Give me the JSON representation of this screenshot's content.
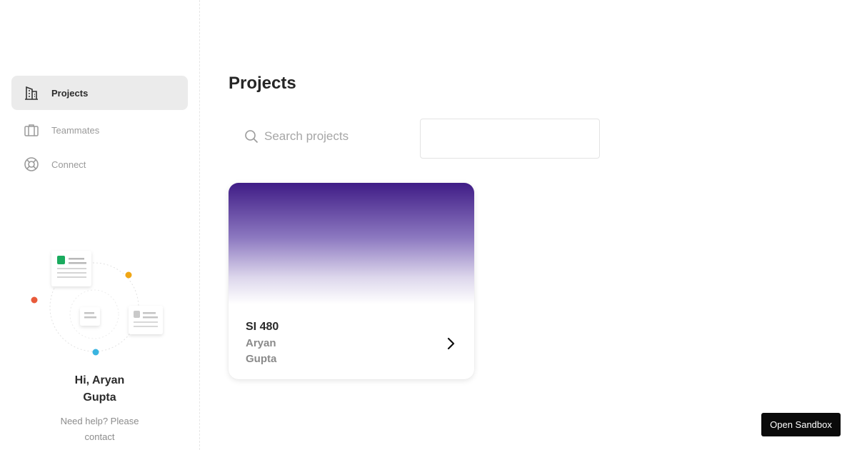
{
  "sidebar": {
    "items": [
      {
        "label": "Projects",
        "icon": "building-icon",
        "active": true
      },
      {
        "label": "Teammates",
        "icon": "briefcase-icon",
        "active": false
      },
      {
        "label": "Connect",
        "icon": "lifebuoy-icon",
        "active": false
      }
    ],
    "greeting": "Hi, Aryan Gupta",
    "help_text": "Need help? Please contact"
  },
  "main": {
    "title": "Projects",
    "search": {
      "placeholder": "Search projects",
      "value": ""
    }
  },
  "projects": [
    {
      "name": "SI 480",
      "owner": "Aryan Gupta"
    }
  ],
  "sandbox_button": "Open Sandbox",
  "colors": {
    "banner_top": "#3f1c86",
    "active_nav_bg": "#ebebeb",
    "illus_green": "#1aab5e",
    "illus_orange": "#f0a614",
    "illus_red": "#e85a3a",
    "illus_blue": "#3ab4e0"
  }
}
